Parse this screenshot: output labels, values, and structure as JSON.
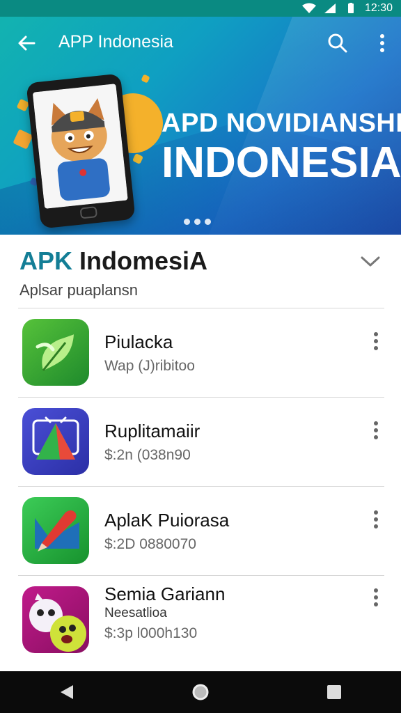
{
  "status": {
    "time": "12:30"
  },
  "appbar": {
    "title": "APP Indonesia"
  },
  "hero": {
    "line1": "APD NOVIDIANSHH",
    "line2": "INDONESIA"
  },
  "section": {
    "title_accent": "APK",
    "title_rest": " IndomesiA",
    "subtitle": "Aplsar puaplansn"
  },
  "apps": [
    {
      "title": "Piulacka",
      "sub": "Wap (J)ribitoo",
      "icon": "leaf-app-icon",
      "color": "#2ea33a"
    },
    {
      "title": "Ruplitamaiir",
      "sub": "$:2n (038n90",
      "icon": "triangle-app-icon",
      "color": "#3d3fc4"
    },
    {
      "title": "AplaK Puiorasa",
      "sub": "$:2D 0880070",
      "icon": "marker-app-icon",
      "color": "#22a63e"
    },
    {
      "title": "Semia Gariann",
      "sub": "Neesatlioa",
      "sub2": "$:3p l000h130",
      "icon": "monster-app-icon",
      "color": "#a0137a"
    }
  ]
}
